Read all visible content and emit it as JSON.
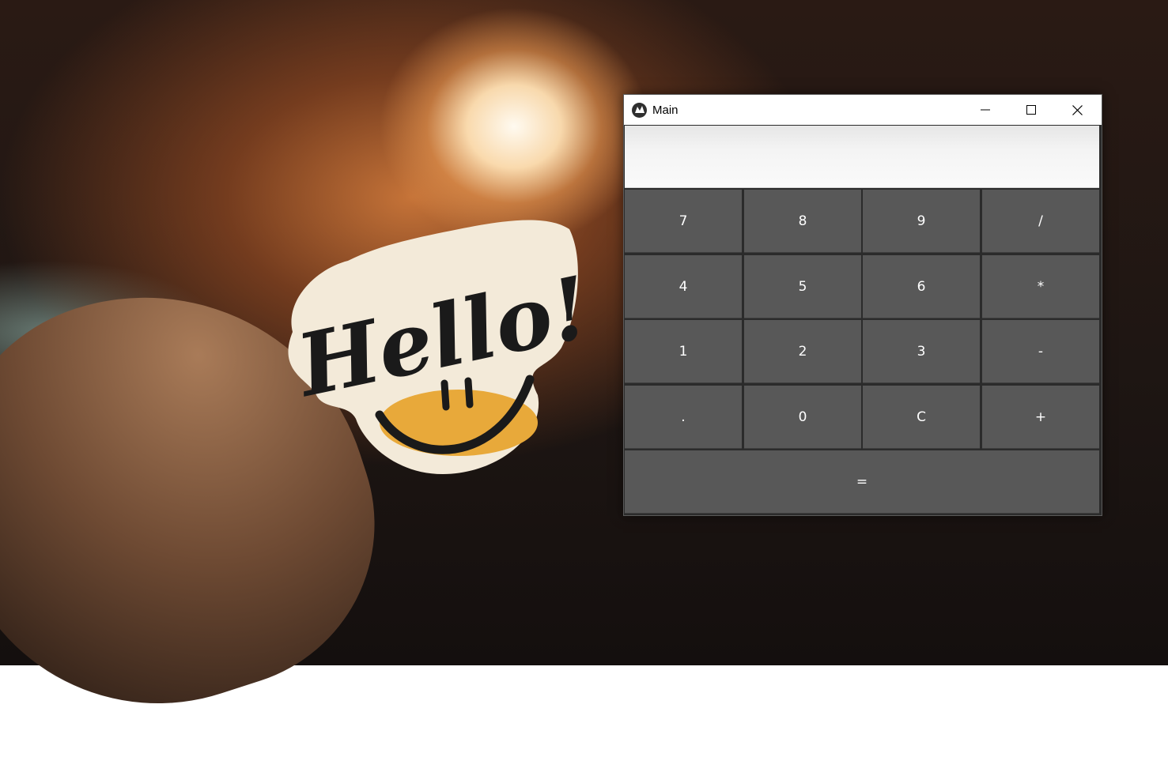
{
  "window": {
    "title": "Main",
    "app_icon": "kivy-logo-icon",
    "controls": [
      "minimize-icon",
      "maximize-icon",
      "close-icon"
    ]
  },
  "display": {
    "value": ""
  },
  "keypad": {
    "rows": [
      [
        "7",
        "8",
        "9",
        "/"
      ],
      [
        "4",
        "5",
        "6",
        "*"
      ],
      [
        "1",
        "2",
        "3",
        "-"
      ],
      [
        ".",
        "0",
        "C",
        "+"
      ]
    ],
    "equals": "="
  },
  "background": {
    "sticker_text": "Hello!"
  },
  "colors": {
    "button_bg": "#585858",
    "button_text": "#ffffff",
    "titlebar_bg": "#ffffff",
    "display_bg": "#f2f2f2",
    "window_bg": "#2b2b2b"
  }
}
